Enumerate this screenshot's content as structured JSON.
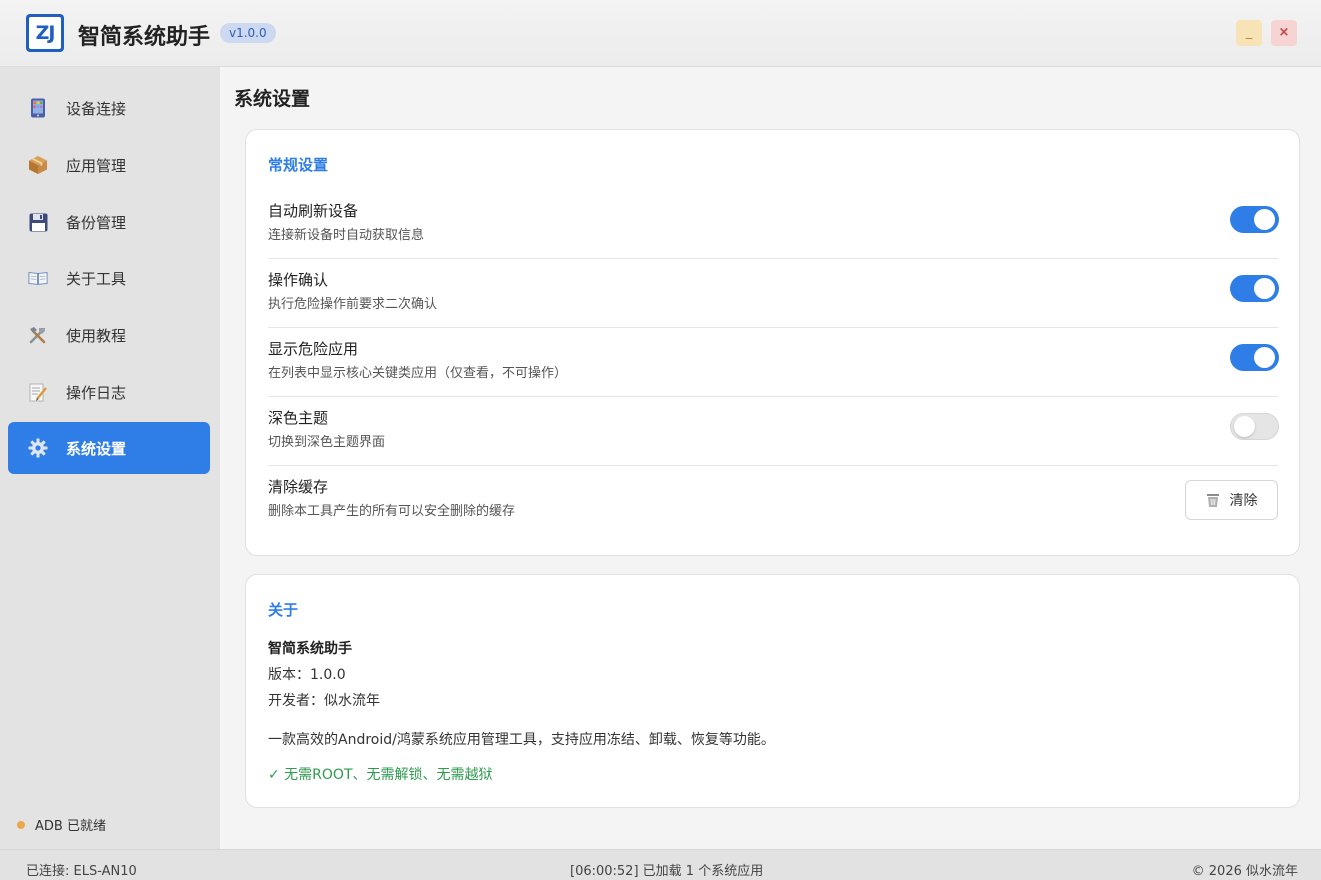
{
  "app": {
    "logo_text": "ZJ",
    "title": "智简系统助手",
    "version": "v1.0.0",
    "minimize_label": "_",
    "close_label": "×"
  },
  "sidebar": {
    "items": [
      {
        "label": "设备连接",
        "icon": "phone-icon"
      },
      {
        "label": "应用管理",
        "icon": "package-icon"
      },
      {
        "label": "备份管理",
        "icon": "floppy-disk-icon"
      },
      {
        "label": "关于工具",
        "icon": "book-icon"
      },
      {
        "label": "使用教程",
        "icon": "tools-icon"
      },
      {
        "label": "操作日志",
        "icon": "memo-icon"
      },
      {
        "label": "系统设置",
        "icon": "gear-icon",
        "active": true
      }
    ],
    "adb_status": "ADB 已就绪"
  },
  "main": {
    "page_title": "系统设置",
    "general": {
      "title": "常规设置",
      "settings": [
        {
          "name": "自动刷新设备",
          "desc": "连接新设备时自动获取信息",
          "enabled": true
        },
        {
          "name": "操作确认",
          "desc": "执行危险操作前要求二次确认",
          "enabled": true
        },
        {
          "name": "显示危险应用",
          "desc": "在列表中显示核心关键类应用（仅查看，不可操作）",
          "enabled": true
        },
        {
          "name": "深色主题",
          "desc": "切换到深色主题界面",
          "enabled": false
        }
      ],
      "clear_cache": {
        "name": "清除缓存",
        "desc": "删除本工具产生的所有可以安全删除的缓存",
        "button": "清除"
      }
    },
    "about": {
      "title": "关于",
      "name": "智简系统助手",
      "version_label": "版本：",
      "version_value": "1.0.0",
      "developer_label": "开发者：",
      "developer_value": "似水流年",
      "description": "一款高效的Android/鸿蒙系统应用管理工具，支持应用冻结、卸载、恢复等功能。",
      "features": "✓ 无需ROOT、无需解锁、无需越狱"
    }
  },
  "statusbar": {
    "connected": "已连接: ELS-AN10",
    "log": "[06:00:52] 已加载 1 个系统应用",
    "copyright": "© 2026 似水流年"
  },
  "colors": {
    "accent": "#2f7de6",
    "success": "#2e9a4e",
    "adb_dot": "#e9a84a"
  }
}
